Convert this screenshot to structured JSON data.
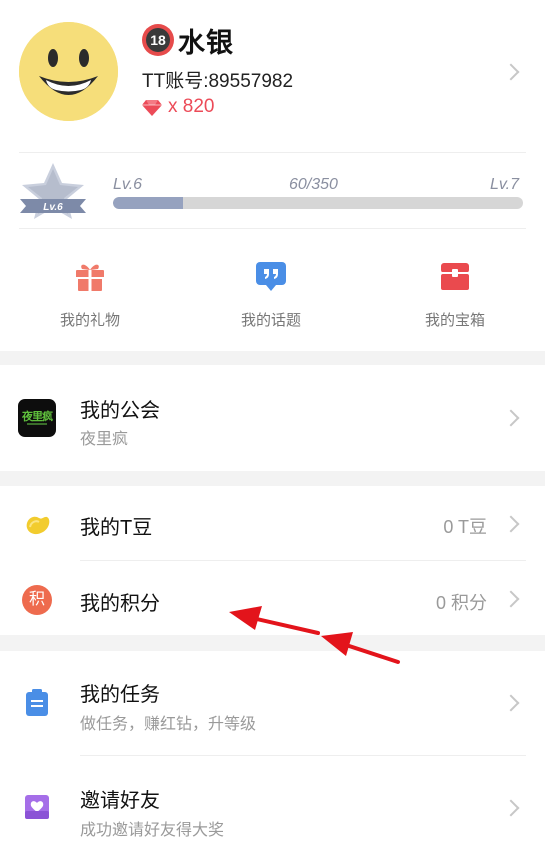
{
  "profile": {
    "age_badge": "18",
    "name": "水银",
    "account": "TT账号:89557982",
    "diamonds": "x 820"
  },
  "level": {
    "star_label": "Lv.6",
    "current": "Lv.6",
    "progress_text": "60/350",
    "next": "Lv.7",
    "progress_fraction": 0.171
  },
  "quick_actions": [
    {
      "label": "我的礼物",
      "icon": "gift-icon"
    },
    {
      "label": "我的话题",
      "icon": "topic-icon"
    },
    {
      "label": "我的宝箱",
      "icon": "treasure-chest-icon"
    }
  ],
  "guild": {
    "title": "我的公会",
    "subtitle": "夜里疯",
    "logo_text": "夜里疯"
  },
  "tbean": {
    "title": "我的T豆",
    "value": "0 T豆"
  },
  "points": {
    "title": "我的积分",
    "value": "0 积分",
    "icon_char": "积"
  },
  "tasks": {
    "title": "我的任务",
    "subtitle": "做任务，赚红钻，升等级"
  },
  "invite": {
    "title": "邀请好友",
    "subtitle": "成功邀请好友得大奖"
  },
  "colors": {
    "accent_red": "#ec4b58",
    "level_bar": "#96a2bf",
    "avatar_yellow": "#f6de7a",
    "annotation_red": "#e3141b"
  }
}
